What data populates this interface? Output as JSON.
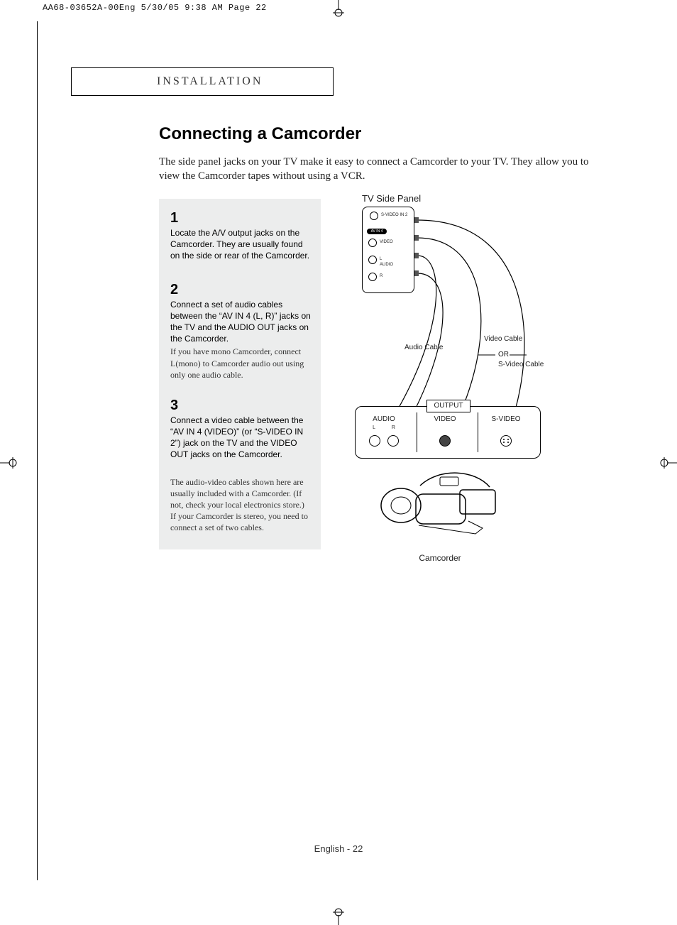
{
  "print_header": "AA68-03652A-00Eng  5/30/05  9:38 AM  Page 22",
  "section_label": "INSTALLATION",
  "title": "Connecting a Camcorder",
  "lead": "The side panel jacks on your TV make it easy to connect a Camcorder to your TV. They allow you to view the Camcorder tapes without using a VCR.",
  "steps": [
    {
      "num": "1",
      "body": "Locate the A/V output jacks on the Camcorder. They are usually found on the side or rear of the Camcorder.",
      "note": ""
    },
    {
      "num": "2",
      "body": "Connect a set of audio cables between the “AV IN 4 (L, R)” jacks on the TV and the AUDIO OUT jacks on the Camcorder.",
      "note": "If you have mono Camcorder, connect L(mono) to Camcorder audio out using only one audio cable."
    },
    {
      "num": "3",
      "body": "Connect a video cable between the “AV IN 4 (VIDEO)” (or “S-VIDEO IN 2”) jack on the TV and the VIDEO OUT jacks on the Camcorder.",
      "note": ""
    }
  ],
  "footnote": "The audio-video cables shown here are usually included with a Camcorder. (If not, check your local electronics store.) If your Camcorder is stereo, you need to connect a set of two cables.",
  "diagram": {
    "tv_caption": "TV Side Panel",
    "tv_labels": {
      "svideo": "S-VIDEO IN 2",
      "avin": "AV IN 4",
      "video": "VIDEO",
      "audio": "AUDIO",
      "l": "L",
      "r": "R"
    },
    "cable_labels": {
      "audio": "Audio Cable",
      "video": "Video Cable",
      "or": "OR",
      "svideo": "S-Video Cable"
    },
    "camcorder_box": {
      "output": "OUTPUT",
      "audio": "AUDIO",
      "video": "VIDEO",
      "svideo": "S-VIDEO",
      "l": "L",
      "r": "R"
    },
    "camcorder_label": "Camcorder"
  },
  "footer": "English - 22"
}
